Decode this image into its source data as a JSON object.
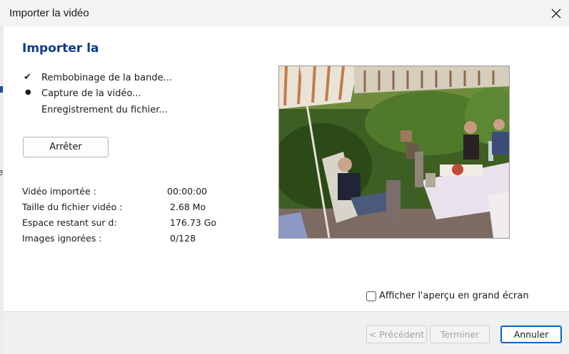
{
  "window": {
    "title": "Importer la vidéo"
  },
  "left_edge_char": "e",
  "main": {
    "heading": "Importer la",
    "steps": [
      {
        "marker": "✔",
        "label": "Rembobinage de la bande..."
      },
      {
        "marker": "●",
        "label": "Capture de la vidéo..."
      },
      {
        "marker": "",
        "label": "Enregistrement du fichier..."
      }
    ],
    "stop_button": "Arrêter",
    "stats": [
      {
        "label": "Vidéo importée :",
        "value": "00:00:00"
      },
      {
        "label": "Taille du fichier vidéo :",
        "value": "2.68 Mo"
      },
      {
        "label": "Espace restant sur d:",
        "value": "176.73 Go"
      },
      {
        "label": "Images ignorées :",
        "value": "0/128"
      }
    ],
    "fullscreen_preview_label": "Afficher l'aperçu en grand écran",
    "fullscreen_preview_checked": false
  },
  "footer": {
    "previous_label": "< Précédent",
    "finish_label": "Terminer",
    "cancel_label": "Annuler"
  },
  "colors": {
    "heading": "#0f3b8c",
    "accent": "#0067c0"
  }
}
